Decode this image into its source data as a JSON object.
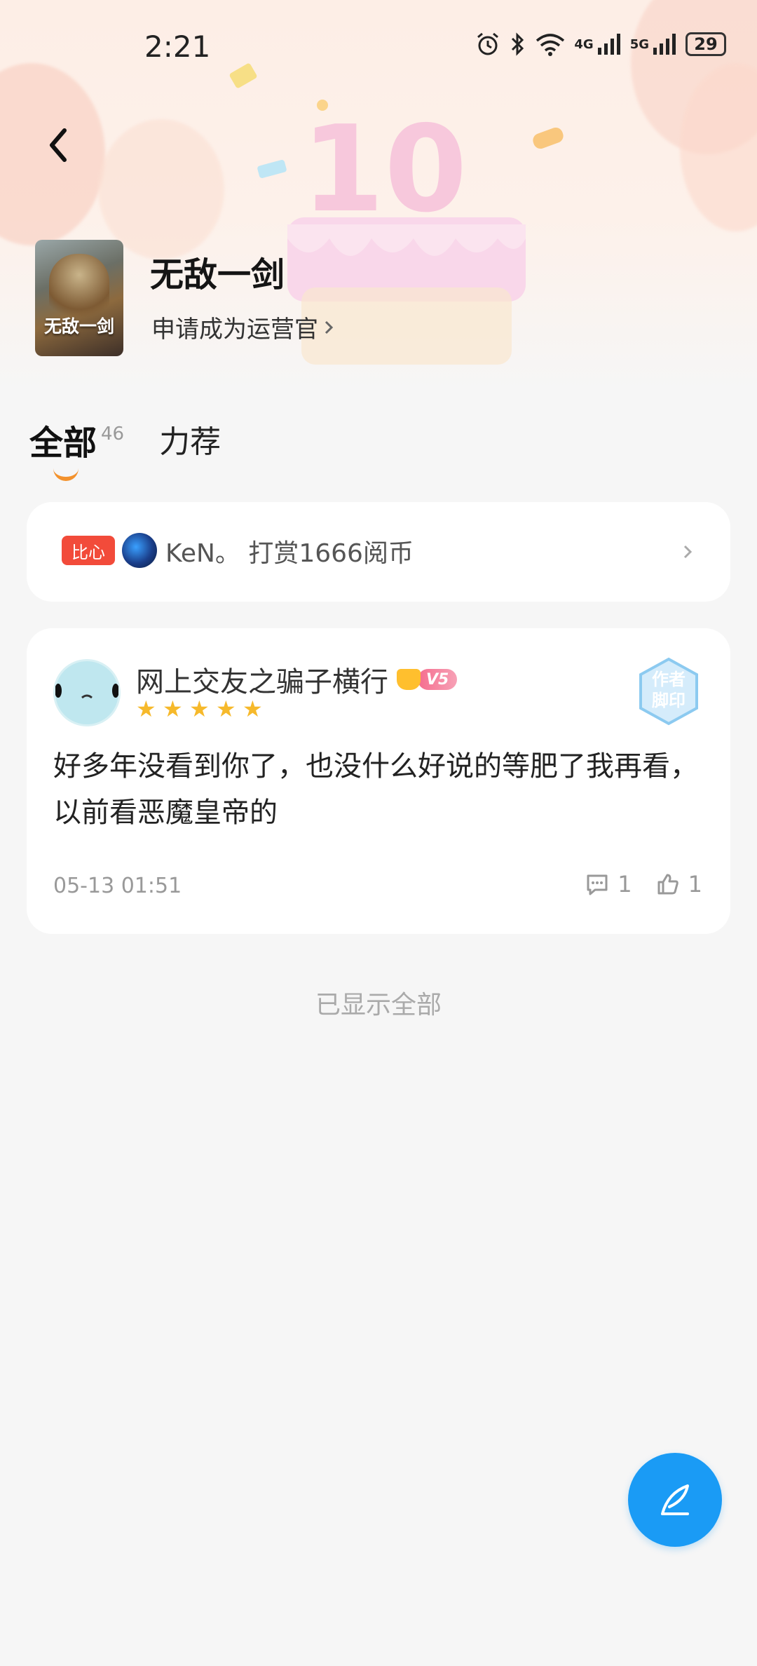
{
  "status_bar": {
    "time": "2:21",
    "battery": "29",
    "net1": "4G",
    "net2": "5G"
  },
  "book": {
    "cover_title": "无敌一剑",
    "title": "无敌一剑",
    "apply_link": "申请成为运营官"
  },
  "tabs": {
    "all_label": "全部",
    "all_count": "46",
    "recommend_label": "力荐"
  },
  "reward": {
    "badge": "比心",
    "text": "KeN。 打赏1666阅币"
  },
  "review": {
    "username": "网上交友之骗子横行",
    "vip_level": "V5",
    "stamp_text": "作者脚印",
    "rating": 5,
    "content": "好多年没看到你了，也没什么好说的等肥了我再看，以前看恶魔皇帝的",
    "time": "05-13 01:51",
    "comments": "1",
    "likes": "1"
  },
  "footer": {
    "all_shown": "已显示全部"
  },
  "colors": {
    "accent": "#1a9bf5",
    "badge": "#f24b3a",
    "star": "#f6b92b",
    "tab_underline": "#f3922d"
  }
}
